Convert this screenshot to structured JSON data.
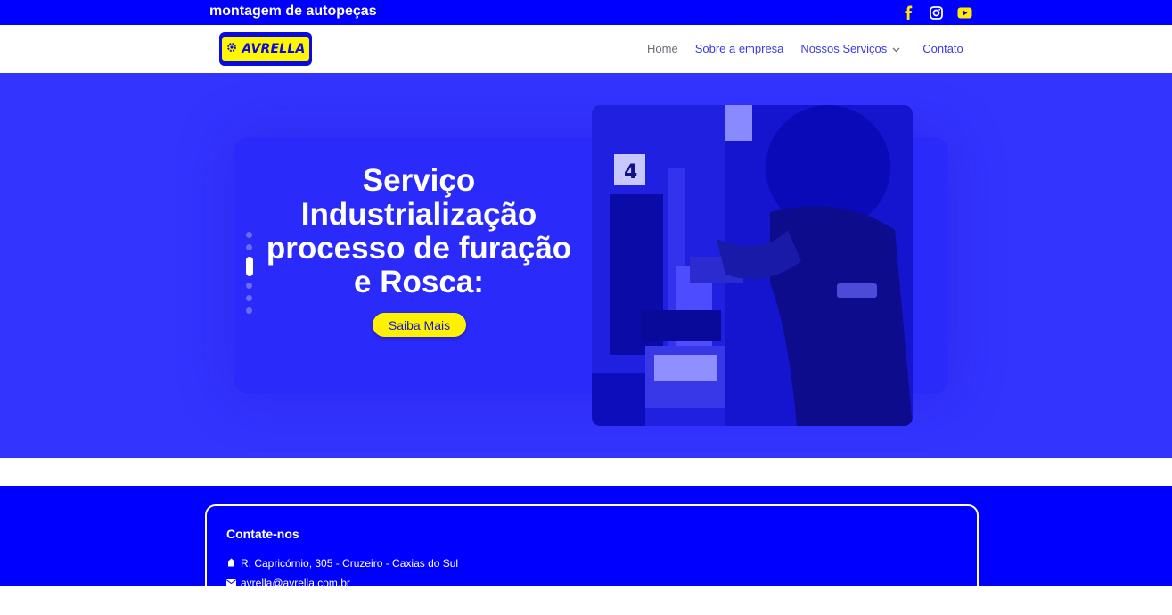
{
  "topbar": {
    "tagline": "montagem de autopeças",
    "social_icons": [
      "facebook-icon",
      "instagram-icon",
      "youtube-icon"
    ]
  },
  "navbar": {
    "logo_text": "AVRELLA",
    "menu": {
      "home": "Home",
      "about": "Sobre a empresa",
      "services": "Nossos Serviços",
      "contact": "Contato"
    }
  },
  "hero": {
    "title": "Serviço Industrialização processo de furação e Rosca:",
    "cta_label": "Saiba Mais",
    "slider": {
      "slide_count": 6,
      "active_index": 2
    }
  },
  "footer": {
    "contact_title": "Contate-nos",
    "address": "R. Capricórnio, 305 - Cruzeiro - Caxias do Sul",
    "email": "avrella@avrella.com.br"
  },
  "colors": {
    "brand_blue": "#0000ff",
    "hero_blue": "#3434ff",
    "accent_yellow": "#fff200",
    "menu_link": "#3a3ae6"
  }
}
